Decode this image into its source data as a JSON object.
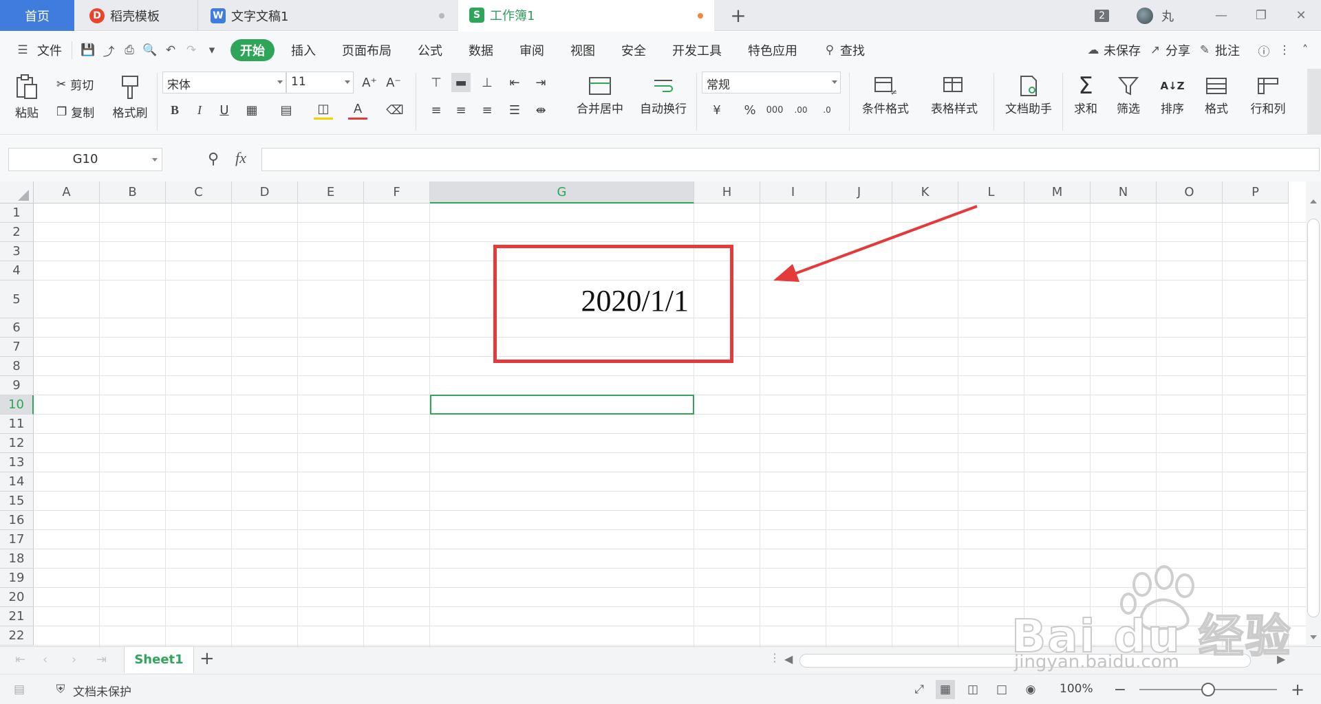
{
  "tabs": {
    "home": "首页",
    "docer": "稻壳模板",
    "doc": "文字文稿1",
    "workbook": "工作簿1",
    "new_tab": "+"
  },
  "window": {
    "count_badge": "2",
    "user_name": "丸"
  },
  "menu": {
    "file": "文件",
    "items": [
      "开始",
      "插入",
      "页面布局",
      "公式",
      "数据",
      "审阅",
      "视图",
      "安全",
      "开发工具",
      "特色应用"
    ],
    "search": "查找",
    "unsaved": "未保存",
    "share": "分享",
    "comment": "批注"
  },
  "ribbon": {
    "paste": "粘贴",
    "cut": "剪切",
    "copy": "复制",
    "format_painter": "格式刷",
    "font_name": "宋体",
    "font_size": "11",
    "merge_center": "合并居中",
    "wrap_text": "自动换行",
    "number_format": "常规",
    "conditional_format": "条件格式",
    "table_style": "表格样式",
    "doc_assistant": "文档助手",
    "sum": "求和",
    "filter": "筛选",
    "sort": "排序",
    "format": "格式",
    "row_col": "行和列"
  },
  "formula_bar": {
    "name_box": "G10",
    "fx": "fx",
    "value": ""
  },
  "grid": {
    "columns": [
      "A",
      "B",
      "C",
      "D",
      "E",
      "F",
      "G",
      "H",
      "I",
      "J",
      "K",
      "L",
      "M",
      "N",
      "O",
      "P"
    ],
    "selected_column": "G",
    "rows": [
      "1",
      "2",
      "3",
      "4",
      "5",
      "6",
      "7",
      "8",
      "9",
      "10",
      "11",
      "12",
      "13",
      "14",
      "15",
      "16",
      "17",
      "18",
      "19",
      "20",
      "21",
      "22"
    ],
    "selected_row": "10",
    "cell_G5": "2020/1/1"
  },
  "sheets": {
    "active": "Sheet1",
    "add": "+"
  },
  "status": {
    "protection": "文档未保护",
    "zoom": "100%"
  },
  "watermark": {
    "brand": "Bai du 经验",
    "url": "jingyan.baidu.com"
  },
  "colors": {
    "accent_green": "#2ea559",
    "home_tab_blue": "#3f7cde",
    "annotation_red": "#e53a3a"
  }
}
